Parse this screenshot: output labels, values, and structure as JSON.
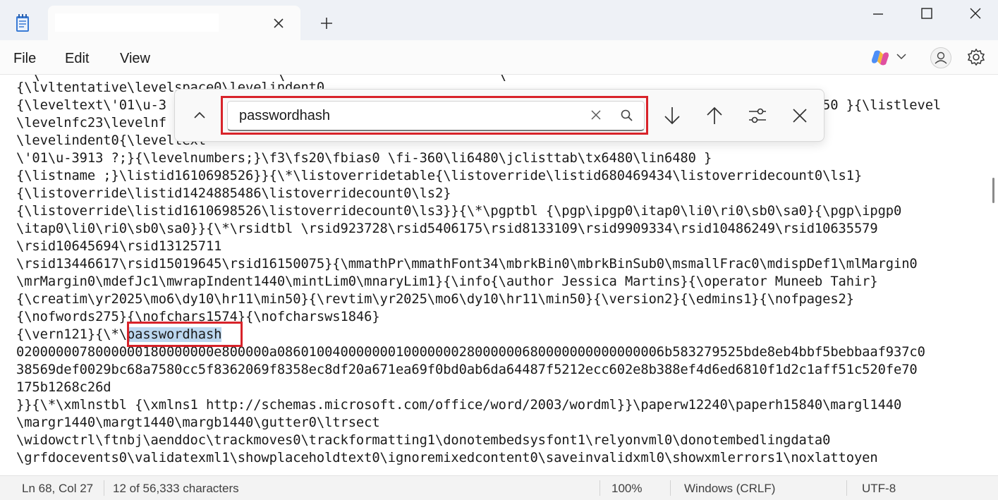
{
  "window": {
    "app_icon": "notepad-icon",
    "tab_title": "",
    "tab_close_icon": "close-icon",
    "new_tab_icon": "plus-icon",
    "minimize_icon": "minimize-icon",
    "maximize_icon": "maximize-icon",
    "close_icon": "close-icon"
  },
  "menu": {
    "items": [
      "File",
      "Edit",
      "View"
    ],
    "copilot_icon": "copilot-icon",
    "account_icon": "account-icon",
    "settings_icon": "gear-icon"
  },
  "find": {
    "value": "passwordhash",
    "icons": [
      "chevron-up-icon",
      "close-icon",
      "search-icon",
      "arrow-down-icon",
      "arrow-up-icon",
      "options-icon",
      "close-icon"
    ]
  },
  "editor": {
    "lines": [
      "{\\lvltentative\\levelspace0\\levelindent0",
      "{\\leveltext\\'01\\u-3",
      "\\levelnfc23\\levelnf",
      "\\levelindent0{\\leveltext",
      "\\'01\\u-3913 ?;}{\\levelnumbers;}\\f3\\fs20\\fbias0 \\fi-360\\li6480\\jclisttab\\tx6480\\lin6480 }",
      "{\\listname ;}\\listid1610698526}}{\\*\\listoverridetable{\\listoverride\\listid680469434\\listoverridecount0\\ls1}",
      "{\\listoverride\\listid1424885486\\listoverridecount0\\ls2}",
      "{\\listoverride\\listid1610698526\\listoverridecount0\\ls3}}{\\*\\pgptbl {\\pgp\\ipgp0\\itap0\\li0\\ri0\\sb0\\sa0}{\\pgp\\ipgp0",
      "\\itap0\\li0\\ri0\\sb0\\sa0}}{\\*\\rsidtbl \\rsid923728\\rsid5406175\\rsid8133109\\rsid9909334\\rsid10486249\\rsid10635579",
      "\\rsid10645694\\rsid13125711",
      "\\rsid13446617\\rsid15019645\\rsid16150075}{\\mmathPr\\mmathFont34\\mbrkBin0\\mbrkBinSub0\\msmallFrac0\\mdispDef1\\mlMargin0",
      "\\mrMargin0\\mdefJc1\\mwrapIndent1440\\mintLim0\\mnaryLim1}{\\info{\\author Jessica Martins}{\\operator Muneeb Tahir}",
      "{\\creatim\\yr2025\\mo6\\dy10\\hr11\\min50}{\\revtim\\yr2025\\mo6\\dy10\\hr11\\min50}{\\version2}{\\edmins1}{\\nofpages2}",
      "{\\nofwords275}{\\nofchars1574}{\\nofcharsws1846}",
      "",
      "0200000078000000180000000e800000a0860100400000001000000028000000680000000000000006b583279525bde8eb4bbf5bebbaaf937c0",
      "38569def0029bc68a7580cc5f8362069f8358ec8df20a671ea69f0bd0ab6da64487f5212ecc602e8b388ef4d6ed6810f1d2c1aff51c520fe70",
      "175b1268c26d",
      "}}{\\*\\xmlnstbl {\\xmlns1 http://schemas.microsoft.com/office/word/2003/wordml}}\\paperw12240\\paperh15840\\margl1440",
      "\\margr1440\\margt1440\\margb1440\\gutter0\\ltrsect",
      "\\widowctrl\\ftnbj\\aenddoc\\trackmoves0\\trackformatting1\\donotembedsysfont1\\relyonvml0\\donotembedlingdata0",
      "\\grfdocevents0\\validatexml1\\showplaceholdtext0\\ignoremixedcontent0\\saveinvalidxml0\\showxmlerrors1\\noxlattoyen"
    ],
    "partial_right_line1": "50 }{\\listlevel",
    "match_line_prefix": "{\\vern121}{\\*\\",
    "match_word": "passwordhash"
  },
  "status": {
    "position": "Ln 68, Col 27",
    "chars": "12 of 56,333 characters",
    "zoom": "100%",
    "eol": "Windows (CRLF)",
    "encoding": "UTF-8"
  },
  "colors": {
    "annotation": "#d8232a",
    "highlight": "#bcd7ef"
  }
}
